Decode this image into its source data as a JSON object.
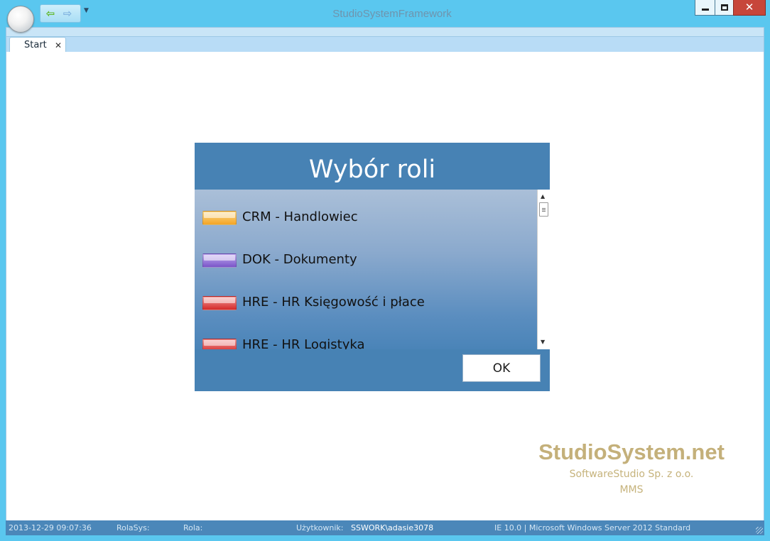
{
  "window": {
    "title": "StudioSystemFramework",
    "controls": [
      "minimize",
      "maximize",
      "close"
    ]
  },
  "quick_access": {
    "back_icon": "back-arrow-icon",
    "forward_icon": "forward-arrow-icon",
    "dropdown_icon": "chevron-down-icon"
  },
  "tabs": [
    {
      "label": "Start",
      "closable": true,
      "active": true
    }
  ],
  "dialog": {
    "title": "Wybór roli",
    "roles": [
      {
        "label": "CRM - Handlowiec",
        "color": "#f4a526"
      },
      {
        "label": "DOK - Dokumenty",
        "color": "#7a55c9"
      },
      {
        "label": "HRE - HR Księgowość i płace",
        "color": "#d42a2a"
      },
      {
        "label": "HRE - HR Logistyka",
        "color": "#d42a2a"
      }
    ],
    "ok_label": "OK"
  },
  "branding": {
    "name": "StudioSystem.net",
    "company": "SoftwareStudio Sp. z o.o.",
    "sub": "MMS"
  },
  "status_bar": {
    "datetime": "2013-12-29 09:07:36",
    "rolasys_label": "RolaSys:",
    "rola_label": "Rola:",
    "user_label": "Użytkownik:",
    "user_value": "SSWORK\\adasie3078",
    "env": "IE 10.0 | Microsoft Windows Server 2012 Standard"
  }
}
